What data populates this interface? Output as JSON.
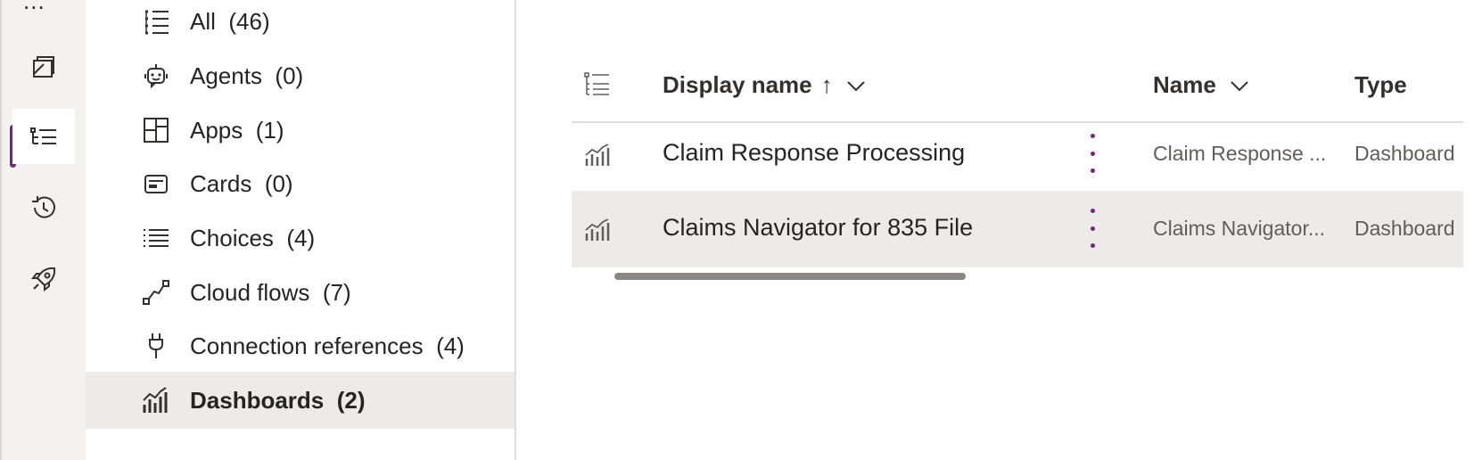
{
  "rail": {
    "more_glyph": "...",
    "items": [
      {
        "icon": "dashboard-window-icon",
        "active": false
      },
      {
        "icon": "list-tree-icon",
        "active": true
      },
      {
        "icon": "history-icon",
        "active": false
      },
      {
        "icon": "rocket-icon",
        "active": false
      }
    ]
  },
  "nav": {
    "items": [
      {
        "label": "All",
        "count": "(46)",
        "icon": "list-icon"
      },
      {
        "label": "Agents",
        "count": "(0)",
        "icon": "bot-icon"
      },
      {
        "label": "Apps",
        "count": "(1)",
        "icon": "apps-grid-icon"
      },
      {
        "label": "Cards",
        "count": "(0)",
        "icon": "card-icon"
      },
      {
        "label": "Choices",
        "count": "(4)",
        "icon": "choices-list-icon"
      },
      {
        "label": "Cloud flows",
        "count": "(7)",
        "icon": "flow-icon"
      },
      {
        "label": "Connection references",
        "count": "(4)",
        "icon": "plug-icon"
      },
      {
        "label": "Dashboards",
        "count": "(2)",
        "icon": "dashboard-chart-icon",
        "selected": true
      }
    ]
  },
  "grid": {
    "columns": {
      "display_name": "Display name",
      "sort_arrow": "↑",
      "name": "Name",
      "type": "Type"
    },
    "rows": [
      {
        "display_name": "Claim Response Processing",
        "name": "Claim Response ...",
        "type": "Dashboard"
      },
      {
        "display_name": "Claims Navigator for 835 File",
        "name": "Claims Navigator...",
        "type": "Dashboard"
      }
    ]
  },
  "colors": {
    "accent": "#742774",
    "selected_bg": "#edebe9",
    "rail_bg": "#f3f2f1"
  }
}
